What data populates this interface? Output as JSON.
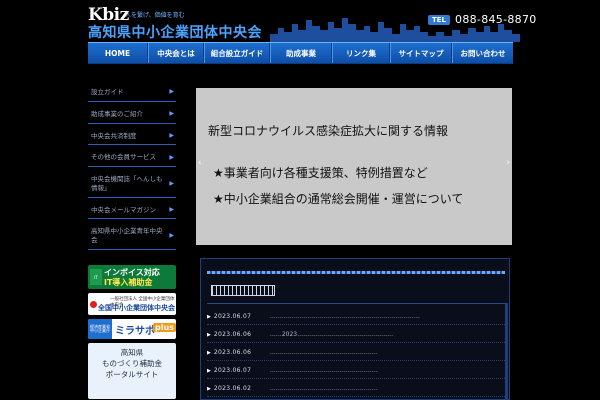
{
  "header": {
    "logo_kbiz": "Kbiz",
    "logo_tagline": "人を繋げ、価値を育む",
    "logo_name": "高知県中小企業団体中央会",
    "tel_label": "TEL",
    "tel_number": "088-845-8870"
  },
  "nav": {
    "items": [
      {
        "label": "HOME"
      },
      {
        "label": "中央会とは"
      },
      {
        "label": "組合設立ガイド"
      },
      {
        "label": "助成事業"
      },
      {
        "label": "リンク集"
      },
      {
        "label": "サイトマップ"
      },
      {
        "label": "お問い合わせ"
      }
    ]
  },
  "sidebar": {
    "items": [
      {
        "label": "設立ガイド"
      },
      {
        "label": "助成事業のご紹介"
      },
      {
        "label": "中央会共済制度"
      },
      {
        "label": "その他の会員サービス"
      },
      {
        "label": "中央会機関誌「へんしも情報」"
      },
      {
        "label": "中央会メールマガジン"
      },
      {
        "label": "高知県中小企業青年中央会"
      }
    ]
  },
  "banners": {
    "invoice_badge": "IT",
    "invoice_line1": "インボイス対応",
    "invoice_line2": "IT導入補助金",
    "national_line1": "一般社団法人 全国中小企業団体中央会",
    "national_line2": "全国中小企業団体中央会",
    "mirasapo_left": "経済産業省 中小企業庁",
    "mirasapo_text": "ミラサポ",
    "mirasapo_plus": "plus",
    "portal_line1": "高知県",
    "portal_line2": "ものづくり補助金",
    "portal_line3": "ポータルサイト"
  },
  "slider": {
    "title": "新型コロナウイルス感染症拡大に関する情報",
    "line1": "★事業者向け各種支援策、特例措置など",
    "line2": "★中小企業組合の通常総会開催・運営について",
    "prev": "‹",
    "next": "›"
  },
  "news": {
    "rows": [
      {
        "date": "2023.06.07",
        "text": "…………………………………………………………………"
      },
      {
        "date": "2023.06.06",
        "text": "……2023…………………………………………"
      },
      {
        "date": "2023.06.06",
        "text": "………………………………………………"
      },
      {
        "date": "2023.06.07",
        "text": "………………………………………………"
      },
      {
        "date": "2023.06.02",
        "text": "………………………………………………"
      }
    ]
  }
}
